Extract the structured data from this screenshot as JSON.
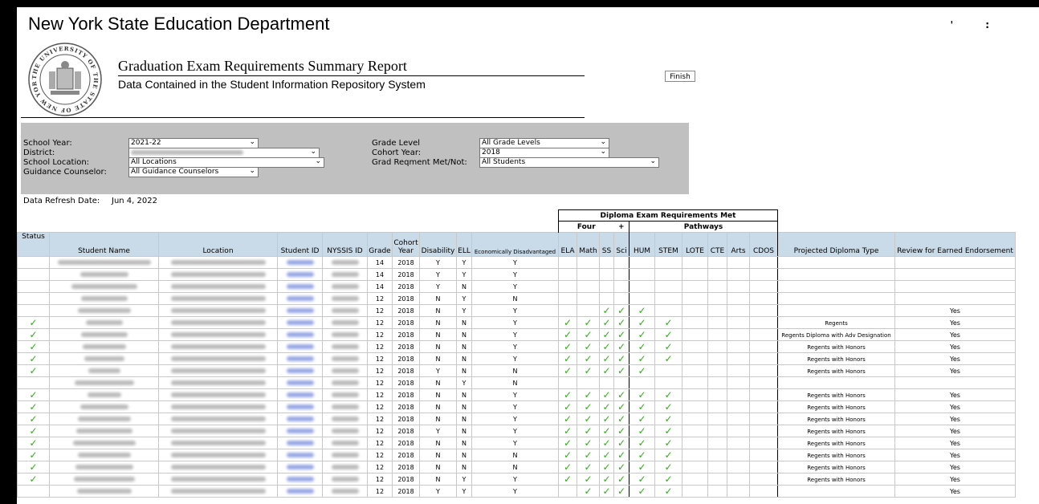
{
  "header": {
    "department": "New York State Education Department",
    "report_title": "Graduation Exam Requirements Summary Report",
    "report_subtitle": "Data Contained in the Student Information Repository System",
    "seal_text": "THE UNIVERSITY OF THE STATE OF NEW YORK",
    "top_marks": [
      "'",
      ":"
    ]
  },
  "filters": {
    "school_year_label": "School Year:",
    "school_year_value": "2021-22",
    "district_label": "District:",
    "school_location_label": "School Location:",
    "school_location_value": "All Locations",
    "guidance_counselor_label": "Guidance Counselor:",
    "guidance_counselor_value": "All Guidance Counselors",
    "grade_level_label": "Grade Level",
    "grade_level_value": "All Grade Levels",
    "cohort_year_label": "Cohort Year:",
    "cohort_year_value": "2018",
    "grad_req_label": "Grad Reqment Met/Not:",
    "grad_req_value": "All Students",
    "finish_label": "Finish"
  },
  "refresh": {
    "label": "Data Refresh Date:",
    "value": "Jun 4, 2022"
  },
  "table": {
    "group_title": "Diploma Exam Requirements Met",
    "group_four": "Four",
    "group_plus": "+",
    "group_pathways": "Pathways",
    "columns": [
      "Status",
      "Student Name",
      "Location",
      "Student ID",
      "NYSSIS ID",
      "Grade",
      "Cohort Year",
      "Disability",
      "ELL",
      "Economically Disadvantaged",
      "ELA",
      "Math",
      "SS",
      "Sci",
      "HUM",
      "STEM",
      "LOTE",
      "CTE",
      "Arts",
      "CDOS",
      "Projected Diploma Type",
      "Review for Earned Endorsement"
    ],
    "rows": [
      {
        "status": "",
        "grade": "14",
        "cohort": "2018",
        "dis": "Y",
        "ell": "Y",
        "econ": "Y",
        "ela": "",
        "math": "",
        "ss": "",
        "sci": "",
        "hum": "",
        "stem": "",
        "diploma": "",
        "review": ""
      },
      {
        "status": "",
        "grade": "14",
        "cohort": "2018",
        "dis": "Y",
        "ell": "Y",
        "econ": "Y",
        "ela": "",
        "math": "",
        "ss": "",
        "sci": "",
        "hum": "",
        "stem": "",
        "diploma": "",
        "review": ""
      },
      {
        "status": "",
        "grade": "14",
        "cohort": "2018",
        "dis": "Y",
        "ell": "N",
        "econ": "Y",
        "ela": "",
        "math": "",
        "ss": "",
        "sci": "",
        "hum": "",
        "stem": "",
        "diploma": "",
        "review": ""
      },
      {
        "status": "",
        "grade": "12",
        "cohort": "2018",
        "dis": "N",
        "ell": "Y",
        "econ": "N",
        "ela": "",
        "math": "",
        "ss": "",
        "sci": "",
        "hum": "",
        "stem": "",
        "diploma": "",
        "review": ""
      },
      {
        "status": "",
        "grade": "12",
        "cohort": "2018",
        "dis": "N",
        "ell": "Y",
        "econ": "Y",
        "ela": "",
        "math": "",
        "ss": "✓",
        "sci": "✓",
        "hum": "✓",
        "stem": "",
        "diploma": "",
        "review": "Yes"
      },
      {
        "status": "✓",
        "grade": "12",
        "cohort": "2018",
        "dis": "N",
        "ell": "N",
        "econ": "Y",
        "ela": "✓",
        "math": "✓",
        "ss": "✓",
        "sci": "✓",
        "hum": "✓",
        "stem": "✓",
        "diploma": "Regents",
        "review": "Yes"
      },
      {
        "status": "✓",
        "grade": "12",
        "cohort": "2018",
        "dis": "N",
        "ell": "N",
        "econ": "Y",
        "ela": "✓",
        "math": "✓",
        "ss": "✓",
        "sci": "✓",
        "hum": "✓",
        "stem": "✓",
        "diploma": "Regents Diploma with Adv Designation",
        "review": "Yes"
      },
      {
        "status": "✓",
        "grade": "12",
        "cohort": "2018",
        "dis": "N",
        "ell": "N",
        "econ": "Y",
        "ela": "✓",
        "math": "✓",
        "ss": "✓",
        "sci": "✓",
        "hum": "✓",
        "stem": "✓",
        "diploma": "Regents with Honors",
        "review": "Yes"
      },
      {
        "status": "✓",
        "grade": "12",
        "cohort": "2018",
        "dis": "N",
        "ell": "N",
        "econ": "Y",
        "ela": "✓",
        "math": "✓",
        "ss": "✓",
        "sci": "✓",
        "hum": "✓",
        "stem": "✓",
        "diploma": "Regents with Honors",
        "review": "Yes"
      },
      {
        "status": "✓",
        "grade": "12",
        "cohort": "2018",
        "dis": "Y",
        "ell": "N",
        "econ": "N",
        "ela": "✓",
        "math": "✓",
        "ss": "✓",
        "sci": "✓",
        "hum": "✓",
        "stem": "",
        "diploma": "Regents with Honors",
        "review": "Yes"
      },
      {
        "status": "",
        "grade": "12",
        "cohort": "2018",
        "dis": "N",
        "ell": "Y",
        "econ": "N",
        "ela": "",
        "math": "",
        "ss": "",
        "sci": "",
        "hum": "",
        "stem": "",
        "diploma": "",
        "review": ""
      },
      {
        "status": "✓",
        "grade": "12",
        "cohort": "2018",
        "dis": "N",
        "ell": "N",
        "econ": "Y",
        "ela": "✓",
        "math": "✓",
        "ss": "✓",
        "sci": "✓",
        "hum": "✓",
        "stem": "✓",
        "diploma": "Regents with Honors",
        "review": "Yes"
      },
      {
        "status": "✓",
        "grade": "12",
        "cohort": "2018",
        "dis": "N",
        "ell": "N",
        "econ": "Y",
        "ela": "✓",
        "math": "✓",
        "ss": "✓",
        "sci": "✓",
        "hum": "✓",
        "stem": "✓",
        "diploma": "Regents with Honors",
        "review": "Yes"
      },
      {
        "status": "✓",
        "grade": "12",
        "cohort": "2018",
        "dis": "N",
        "ell": "N",
        "econ": "Y",
        "ela": "✓",
        "math": "✓",
        "ss": "✓",
        "sci": "✓",
        "hum": "✓",
        "stem": "✓",
        "diploma": "Regents with Honors",
        "review": "Yes"
      },
      {
        "status": "✓",
        "grade": "12",
        "cohort": "2018",
        "dis": "Y",
        "ell": "N",
        "econ": "Y",
        "ela": "✓",
        "math": "✓",
        "ss": "✓",
        "sci": "✓",
        "hum": "✓",
        "stem": "✓",
        "diploma": "Regents with Honors",
        "review": "Yes"
      },
      {
        "status": "✓",
        "grade": "12",
        "cohort": "2018",
        "dis": "N",
        "ell": "N",
        "econ": "Y",
        "ela": "✓",
        "math": "✓",
        "ss": "✓",
        "sci": "✓",
        "hum": "✓",
        "stem": "✓",
        "diploma": "Regents with Honors",
        "review": "Yes"
      },
      {
        "status": "✓",
        "grade": "12",
        "cohort": "2018",
        "dis": "N",
        "ell": "N",
        "econ": "N",
        "ela": "✓",
        "math": "✓",
        "ss": "✓",
        "sci": "✓",
        "hum": "✓",
        "stem": "✓",
        "diploma": "Regents with Honors",
        "review": "Yes"
      },
      {
        "status": "✓",
        "grade": "12",
        "cohort": "2018",
        "dis": "N",
        "ell": "N",
        "econ": "N",
        "ela": "✓",
        "math": "✓",
        "ss": "✓",
        "sci": "✓",
        "hum": "✓",
        "stem": "✓",
        "diploma": "Regents with Honors",
        "review": "Yes"
      },
      {
        "status": "✓",
        "grade": "12",
        "cohort": "2018",
        "dis": "N",
        "ell": "Y",
        "econ": "Y",
        "ela": "✓",
        "math": "✓",
        "ss": "✓",
        "sci": "✓",
        "hum": "✓",
        "stem": "✓",
        "diploma": "Regents with Honors",
        "review": "Yes"
      },
      {
        "status": "",
        "grade": "12",
        "cohort": "2018",
        "dis": "Y",
        "ell": "Y",
        "econ": "Y",
        "ela": "",
        "math": "✓",
        "ss": "✓",
        "sci": "✓",
        "hum": "✓",
        "stem": "✓",
        "diploma": "",
        "review": "Yes"
      }
    ]
  },
  "colors": {
    "check": "#2eab16",
    "header_bg": "#c9dbe9",
    "filter_bg": "#c0c0c0"
  }
}
